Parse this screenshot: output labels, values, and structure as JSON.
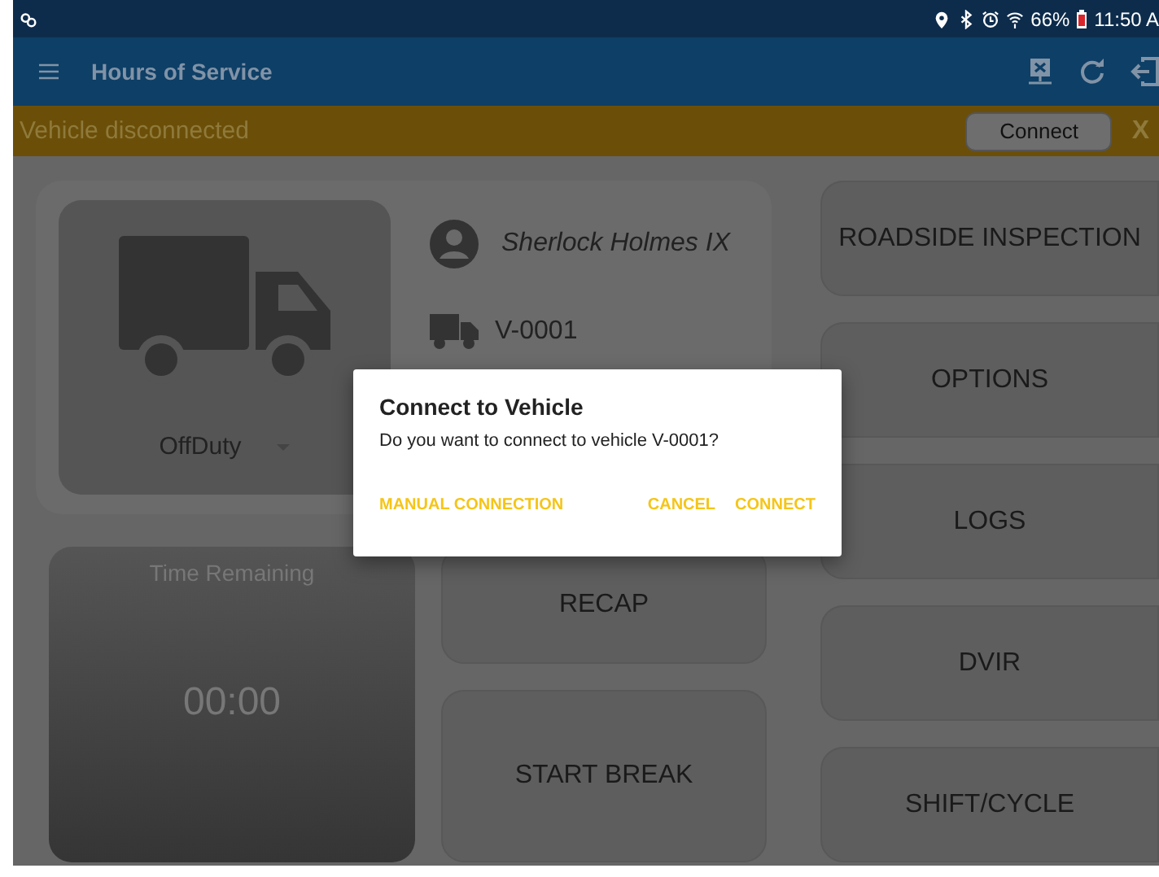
{
  "status_bar": {
    "battery": "66%",
    "time": "11:50 A"
  },
  "app_bar": {
    "title": "Hours of Service"
  },
  "banner": {
    "message": "Vehicle disconnected",
    "button": "Connect",
    "close": "X"
  },
  "driver": {
    "status": "OffDuty",
    "name": "Sherlock Holmes IX",
    "vehicle": "V-0001"
  },
  "timer": {
    "label": "Time Remaining",
    "value": "00:00"
  },
  "center_buttons": [
    "RECAP",
    "START BREAK"
  ],
  "side_buttons": [
    "ROADSIDE INSPECTION",
    "OPTIONS",
    "LOGS",
    "DVIR",
    "SHIFT/CYCLE"
  ],
  "dialog": {
    "title": "Connect to Vehicle",
    "message": "Do you want to connect to vehicle V-0001?",
    "actions": [
      "MANUAL CONNECTION",
      "CANCEL",
      "CONNECT"
    ]
  }
}
